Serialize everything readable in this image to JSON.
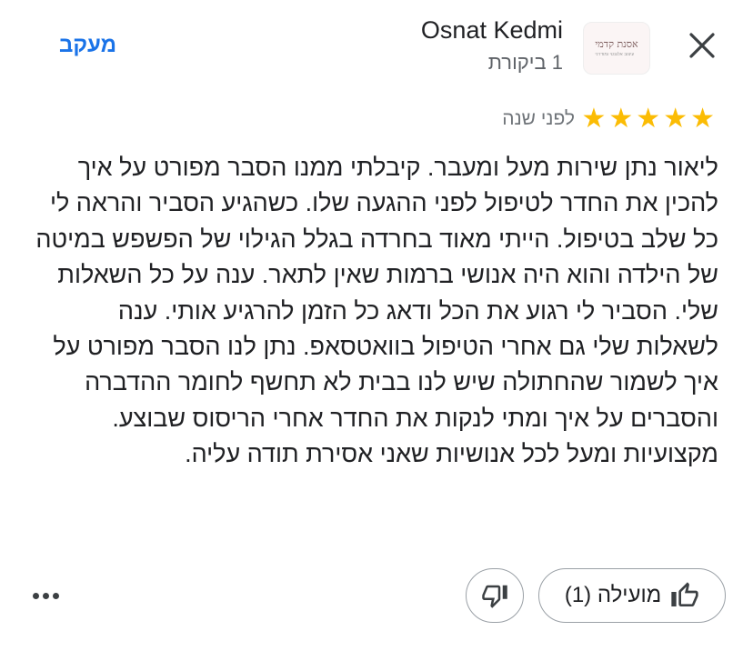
{
  "header": {
    "author_name": "Osnat Kedmi",
    "author_meta": "1 ביקורת",
    "follow_label": "מעקב",
    "avatar_logo_text": "אסנת קדמי",
    "avatar_logo_sub": "עיצוב אלגנטי ומודרני"
  },
  "review": {
    "rating": 5,
    "stars": [
      "★",
      "★",
      "★",
      "★",
      "★"
    ],
    "time_ago": "לפני שנה",
    "text": "ליאור נתן שירות מעל ומעבר. קיבלתי ממנו הסבר מפורט על איך להכין את החדר לטיפול לפני ההגעה שלו. כשהגיע הסביר והראה לי כל שלב בטיפול. הייתי מאוד בחרדה בגלל הגילוי של הפשפש במיטה של הילדה והוא היה אנושי ברמות שאין לתאר. ענה על כל השאלות שלי. הסביר לי רגוע את הכל ודאג כל הזמן להרגיע אותי. ענה לשאלות שלי גם אחרי הטיפול בוואטסאפ. נתן לנו הסבר מפורט על איך לשמור שהחתולה שיש לנו בבית לא תחשף לחומר ההדברה והסברים על איך ומתי לנקות את החדר אחרי הריסוס שבוצע. מקצועיות ומעל לכל אנושיות שאני אסירת תודה עליה."
  },
  "actions": {
    "helpful_label": "מועילה (1)",
    "icons": {
      "close": "close-icon",
      "thumbs_up": "thumbs-up-icon",
      "thumbs_down": "thumbs-down-icon",
      "more": "more-horizontal-icon"
    }
  },
  "colors": {
    "accent": "#1a73e8",
    "star": "#fbbc04",
    "text": "#202124",
    "muted": "#5f6368"
  }
}
